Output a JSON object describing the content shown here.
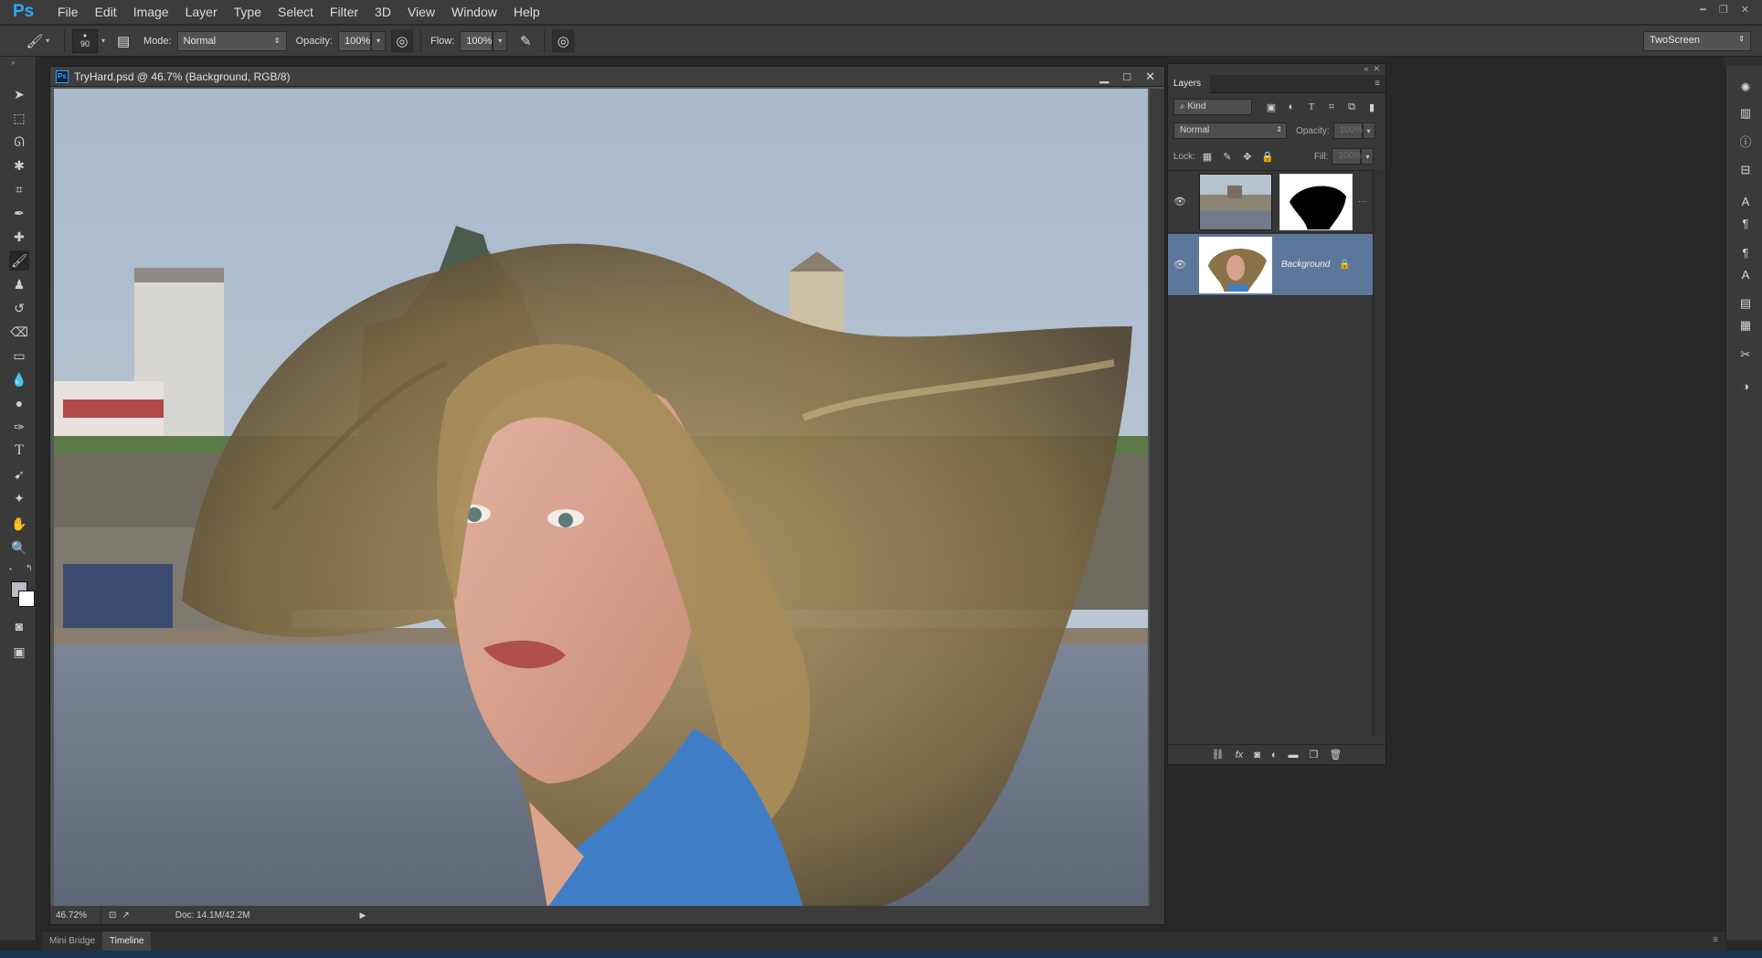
{
  "app": {
    "logo": "Ps"
  },
  "menu": [
    "File",
    "Edit",
    "Image",
    "Layer",
    "Type",
    "Select",
    "Filter",
    "3D",
    "View",
    "Window",
    "Help"
  ],
  "options": {
    "brush_size": "90",
    "mode_label": "Mode:",
    "mode_value": "Normal",
    "opacity_label": "Opacity:",
    "opacity_value": "100%",
    "flow_label": "Flow:",
    "flow_value": "100%",
    "workspace": "TwoScreen"
  },
  "document": {
    "title": "TryHard.psd @ 46.7% (Background, RGB/8)",
    "zoom": "46.72%",
    "doc_size": "Doc: 14.1M/42.2M"
  },
  "layers_panel": {
    "tab_label": "Layers",
    "filter_kind": "Kind",
    "blend_mode": "Normal",
    "opacity_label": "Opacity:",
    "opacity_value": "100%",
    "lock_label": "Lock:",
    "fill_label": "Fill:",
    "fill_value": "100%",
    "layers": [
      {
        "name": "",
        "has_mask": true,
        "selected": false
      },
      {
        "name": "Background",
        "has_mask": false,
        "selected": true,
        "locked": true
      }
    ]
  },
  "bottom_tabs": [
    "Mini Bridge",
    "Timeline"
  ],
  "colors": {
    "accent": "#30a8ff",
    "selected_layer": "#5d779b",
    "foreground": "#b7bcc6",
    "background": "#ffffff"
  }
}
